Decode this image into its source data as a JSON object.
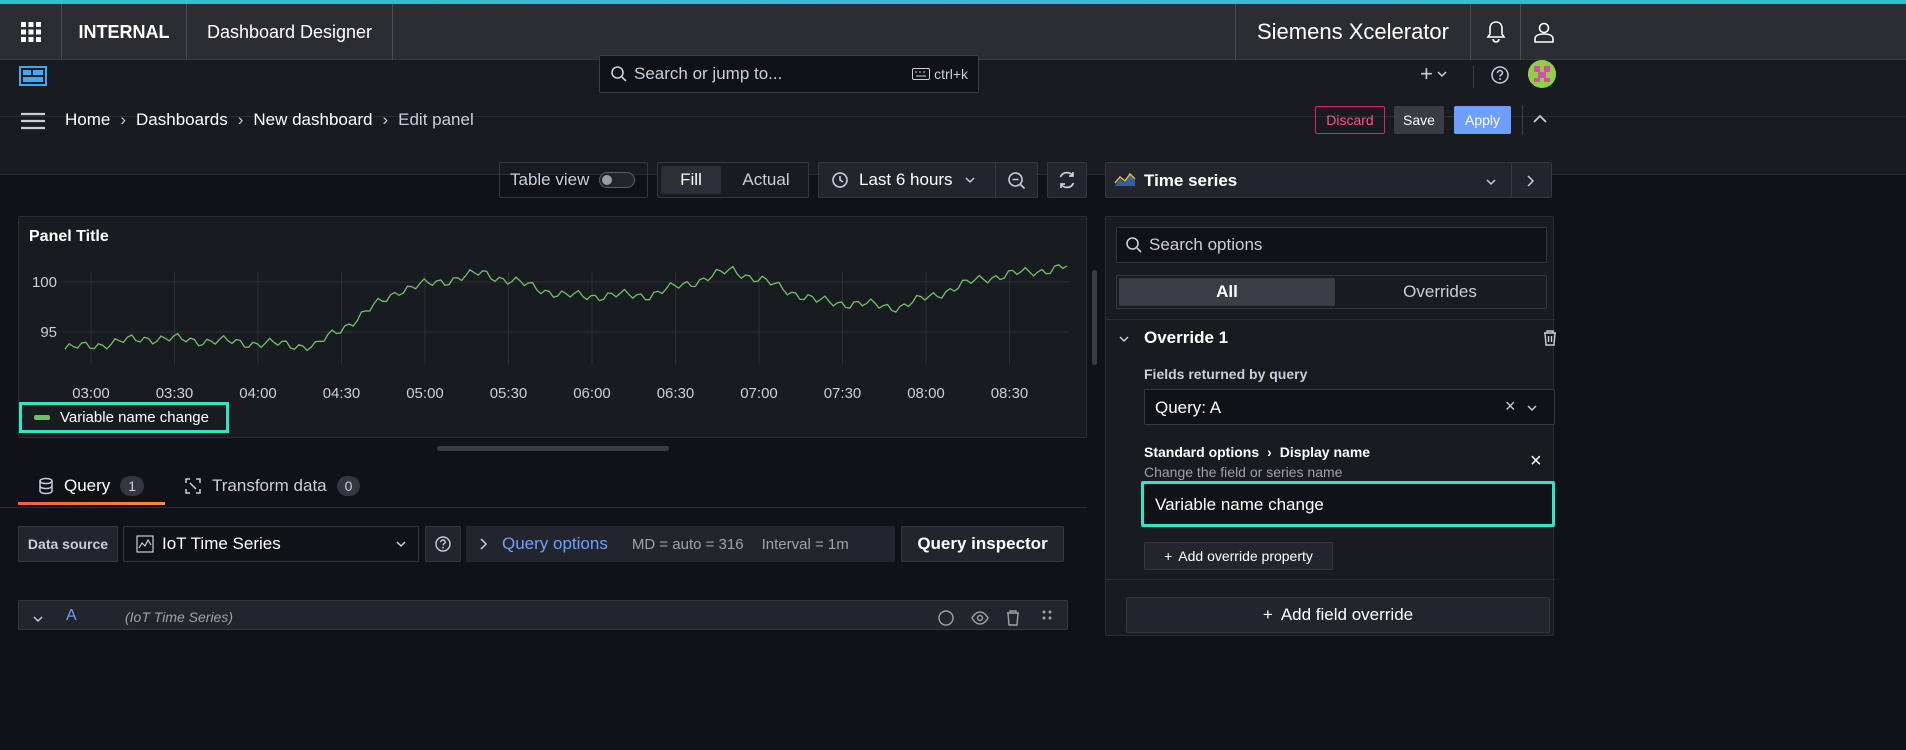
{
  "header": {
    "org": "INTERNAL",
    "app": "Dashboard Designer",
    "brand": "Siemens Xcelerator"
  },
  "topnav": {
    "search_placeholder": "Search or jump to...",
    "search_shortcut": "ctrl+k",
    "add_label": "+"
  },
  "breadcrumb": {
    "items": [
      "Home",
      "Dashboards",
      "New dashboard",
      "Edit panel"
    ],
    "discard": "Discard",
    "save": "Save",
    "apply": "Apply"
  },
  "toolbar": {
    "table_view": "Table view",
    "fill": "Fill",
    "actual": "Actual",
    "time_range": "Last 6 hours"
  },
  "panel": {
    "title": "Panel Title",
    "legend": "Variable name change",
    "line_color": "#73bf69"
  },
  "chart_data": {
    "type": "line",
    "x": [
      "03:00",
      "03:30",
      "04:00",
      "04:30",
      "05:00",
      "05:30",
      "06:00",
      "06:30",
      "07:00",
      "07:30",
      "08:00",
      "08:30"
    ],
    "y_ticks": [
      95,
      100
    ],
    "series": [
      {
        "name": "Variable name change",
        "values": [
          93.3,
          94.4,
          94.0,
          93.6,
          99.2,
          100.9,
          98.6,
          98.7,
          101.2,
          98.1,
          97.5,
          100.4,
          101.5
        ]
      }
    ],
    "grid": true,
    "legend_position": "bottom-left"
  },
  "tabs": {
    "query": "Query",
    "query_count": "1",
    "transform": "Transform data",
    "transform_count": "0"
  },
  "query_row": {
    "data_source_label": "Data source",
    "data_source": "IoT Time Series",
    "query_options": "Query options",
    "md": "MD = auto = 316",
    "interval": "Interval = 1m",
    "inspector": "Query inspector",
    "row_letter": "A",
    "row_source": "(IoT Time Series)"
  },
  "options": {
    "viz": "Time series",
    "search_placeholder": "Search options",
    "tab_all": "All",
    "tab_overrides": "Overrides",
    "override_title": "Override 1",
    "fields_label": "Fields returned by query",
    "fields_value": "Query: A",
    "std_options": "Standard options",
    "display_name": "Display name",
    "display_desc": "Change the field or series name",
    "display_value": "Variable name change",
    "add_property": "Add override property",
    "add_field_override": "Add field override"
  }
}
